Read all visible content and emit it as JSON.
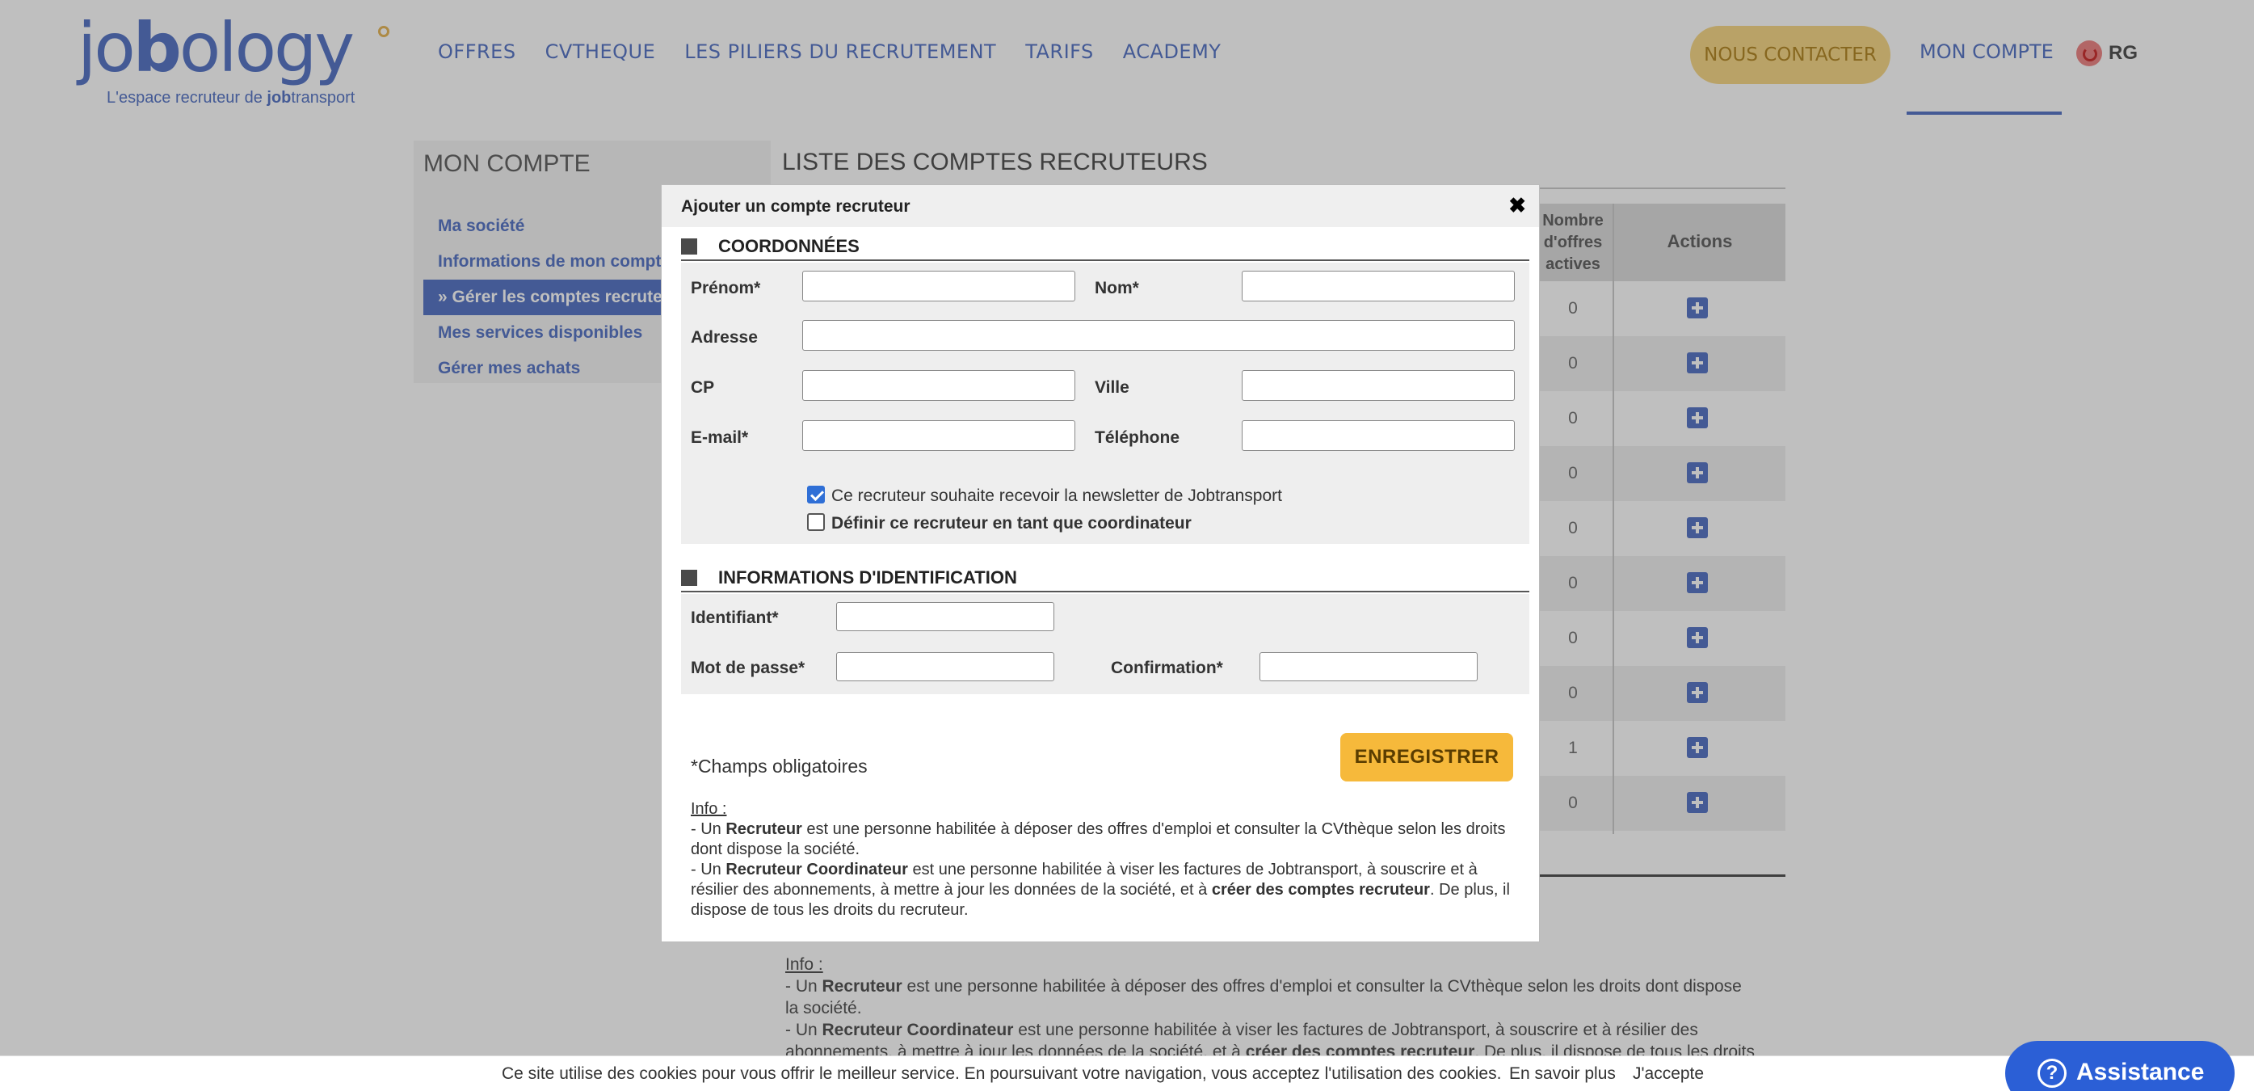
{
  "header": {
    "logo_text_a": "jo",
    "logo_text_b": "b",
    "logo_text_c": "ology",
    "logo_tagline_a": "L'espace recruteur de ",
    "logo_tagline_b": "job",
    "logo_tagline_c": "transport",
    "nav": [
      "OFFRES",
      "CVTHEQUE",
      "LES PILIERS DU RECRUTEMENT",
      "TARIFS",
      "ACADEMY"
    ],
    "contact_label": "NOUS CONTACTER",
    "account_label": "MON COMPTE",
    "user_initials": "RG"
  },
  "sidebar": {
    "title": "MON COMPTE",
    "items": [
      "Ma société",
      "Informations de mon compte",
      "» Gérer les comptes recruteurs",
      "Mes services disponibles",
      "Gérer mes achats"
    ]
  },
  "main": {
    "title": "LISTE DES COMPTES RECRUTEURS",
    "col_offers": "Nombre d'offres actives",
    "col_actions": "Actions",
    "offer_counts": [
      "0",
      "0",
      "0",
      "0",
      "0",
      "0",
      "0",
      "0",
      "1",
      "0"
    ]
  },
  "modal": {
    "title": "Ajouter un compte recruteur",
    "section1": "COORDONNÉES",
    "prenom_label": "Prénom*",
    "nom_label": "Nom*",
    "adresse_label": "Adresse",
    "cp_label": "CP",
    "ville_label": "Ville",
    "email_label": "E-mail*",
    "telephone_label": "Téléphone",
    "newsletter_label": "Ce recruteur souhaite recevoir la newsletter de Jobtransport",
    "newsletter_checked": true,
    "coordinateur_label": "Définir ce recruteur en tant que coordinateur",
    "coordinateur_checked": false,
    "section2": "INFORMATIONS D'IDENTIFICATION",
    "identifiant_label": "Identifiant*",
    "password_label": "Mot de passe*",
    "confirmation_label": "Confirmation*",
    "save_label": "ENREGISTRER",
    "required_note": "*Champs obligatoires",
    "info_title": "Info :",
    "info_l1_a": "- Un ",
    "info_l1_b": "Recruteur",
    "info_l1_c": " est une personne habilitée à déposer des offres d'emploi et consulter la CVthèque selon les droits dont dispose la société.",
    "info_l2_a": "- Un ",
    "info_l2_b": "Recruteur Coordinateur",
    "info_l2_c": " est une personne habilitée à viser les factures de Jobtransport, à souscrire et à résilier des abonnements, à mettre à jour les données de la société, et à ",
    "info_l2_d": "créer des comptes recruteur",
    "info_l2_e": ". De plus, il dispose de tous les droits du recruteur."
  },
  "bg_info": {
    "title": "Info :",
    "l1_a": "- Un ",
    "l1_b": "Recruteur",
    "l1_c": " est une personne habilitée à déposer des offres d'emploi et consulter la CVthèque selon les droits dont dispose la société.",
    "l2_a": "- Un ",
    "l2_b": "Recruteur Coordinateur",
    "l2_c": " est une personne habilitée à viser les factures de Jobtransport, à souscrire et à résilier des abonnements, à mettre à jour les données de la société, et à ",
    "l2_d": "créer des comptes recruteur",
    "l2_e": ". De plus, il dispose de tous les droits du"
  },
  "cookie": {
    "text": "Ce site utilise des cookies pour vous offrir le meilleur service. En poursuivant votre navigation, vous acceptez l'utilisation des cookies.",
    "more": "En savoir plus",
    "accept": "J'accepte"
  },
  "assistance": {
    "label": "Assistance",
    "icon": "?"
  },
  "colors": {
    "brand": "#5b79c7",
    "accent": "#f6b93b",
    "checkbox": "#2f6fd6"
  }
}
